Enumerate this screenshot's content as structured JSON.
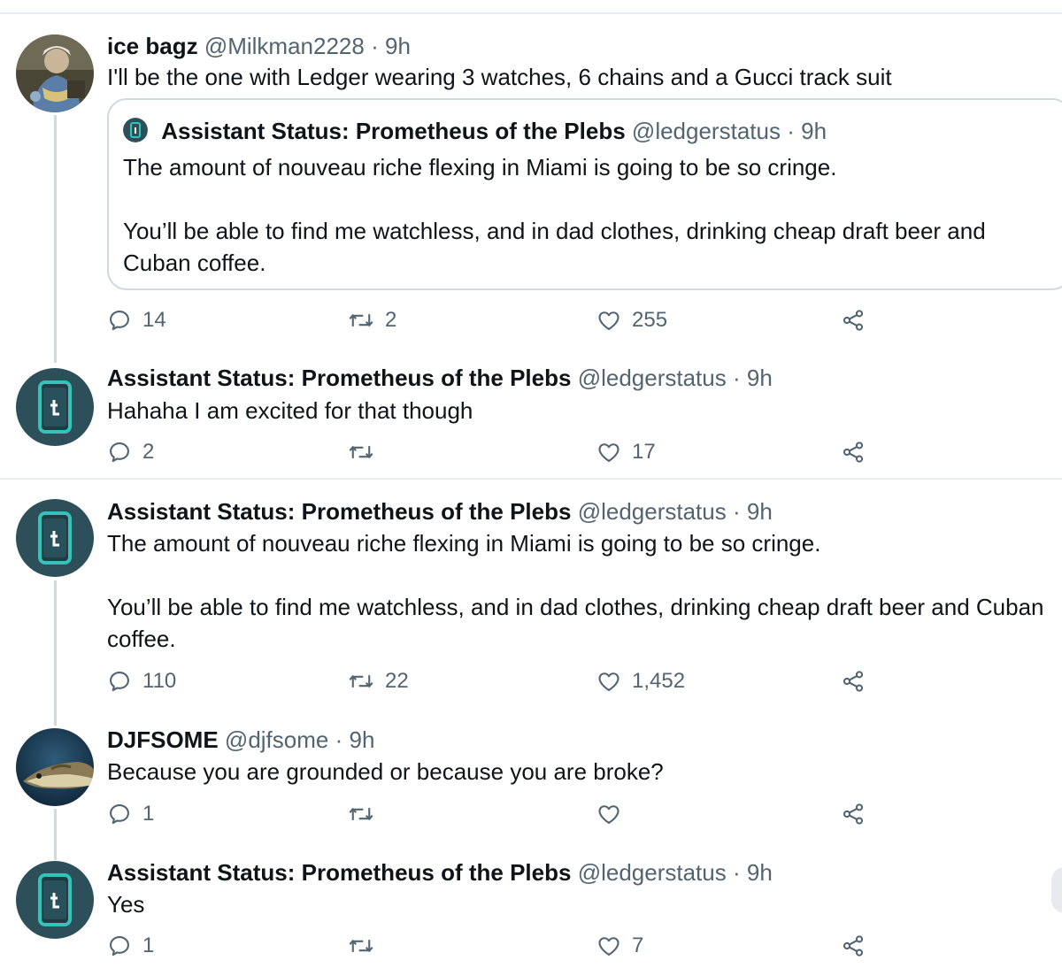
{
  "colors": {
    "text": "#0f1419",
    "muted": "#536471",
    "divider": "#e6ecf0",
    "thread_line": "#cfd9de",
    "avatar_bg": "#2c4f5a",
    "avatar_accent": "#35c2b8"
  },
  "icons": {
    "reply": "speech-bubble-icon",
    "retweet": "retweet-arrows-icon",
    "like": "heart-outline-icon",
    "share": "share-nodes-icon"
  },
  "tweets": [
    {
      "name": "ice bagz",
      "handle": "@Milkman2228",
      "dot": "·",
      "time": "9h",
      "text": "I'll be the one with Ledger wearing 3 watches, 6 chains and a Gucci track suit",
      "quote": {
        "name": "Assistant Status: Prometheus of the Plebs",
        "handle": "@ledgerstatus",
        "dot": "·",
        "time": "9h",
        "paragraphs": [
          "The amount of nouveau riche flexing in Miami is going to be so cringe.",
          "You’ll be able to find me watchless, and in dad clothes, drinking cheap draft beer and Cuban coffee."
        ]
      },
      "replies": "14",
      "retweets": "2",
      "likes": "255"
    },
    {
      "name": "Assistant Status: Prometheus of the Plebs",
      "handle": "@ledgerstatus",
      "dot": "·",
      "time": "9h",
      "text": "Hahaha I am excited for that though",
      "replies": "2",
      "retweets": "",
      "likes": "17"
    },
    {
      "name": "Assistant Status: Prometheus of the Plebs",
      "handle": "@ledgerstatus",
      "dot": "·",
      "time": "9h",
      "paragraphs": [
        "The amount of nouveau riche flexing in Miami is going to be so cringe.",
        "You’ll be able to find me watchless, and in dad clothes, drinking cheap draft beer and Cuban coffee."
      ],
      "replies": "110",
      "retweets": "22",
      "likes": "1,452"
    },
    {
      "name": "DJFSOME",
      "handle": "@djfsome",
      "dot": "·",
      "time": "9h",
      "text": "Because you are grounded or because you are broke?",
      "replies": "1",
      "retweets": "",
      "likes": ""
    },
    {
      "name": "Assistant Status: Prometheus of the Plebs",
      "handle": "@ledgerstatus",
      "dot": "·",
      "time": "9h",
      "text": "Yes",
      "replies": "1",
      "retweets": "",
      "likes": "7"
    }
  ]
}
